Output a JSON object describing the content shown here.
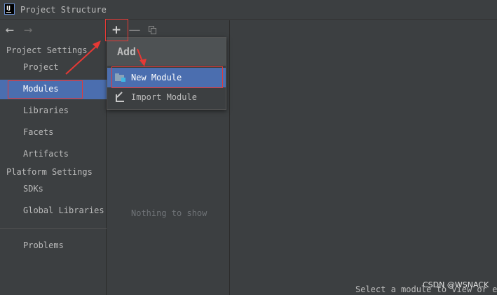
{
  "window": {
    "title": "Project Structure"
  },
  "app_icon": {
    "text": "IJ"
  },
  "nav": {
    "back": "←",
    "forward": "→"
  },
  "toolbar": {
    "add": "+",
    "remove": "—"
  },
  "sidebar": {
    "project_settings_header": "Project Settings",
    "platform_settings_header": "Platform Settings",
    "items": [
      {
        "label": "Project"
      },
      {
        "label": "Modules",
        "selected": true
      },
      {
        "label": "Libraries"
      },
      {
        "label": "Facets"
      },
      {
        "label": "Artifacts"
      },
      {
        "label": "SDKs"
      },
      {
        "label": "Global Libraries"
      },
      {
        "label": "Problems"
      }
    ]
  },
  "middle": {
    "empty_text": "Nothing to show"
  },
  "popup": {
    "title": "Add",
    "items": [
      {
        "label": "New Module",
        "icon": "folder-module-icon",
        "selected": true
      },
      {
        "label": "Import Module",
        "icon": "import-icon"
      }
    ]
  },
  "right_panel": {
    "hint": "Select a module to view or ed"
  },
  "watermark": "CSDN @WSNACK",
  "colors": {
    "background": "#3c3f41",
    "selection": "#4b6eaf",
    "annotation": "#e53935"
  }
}
